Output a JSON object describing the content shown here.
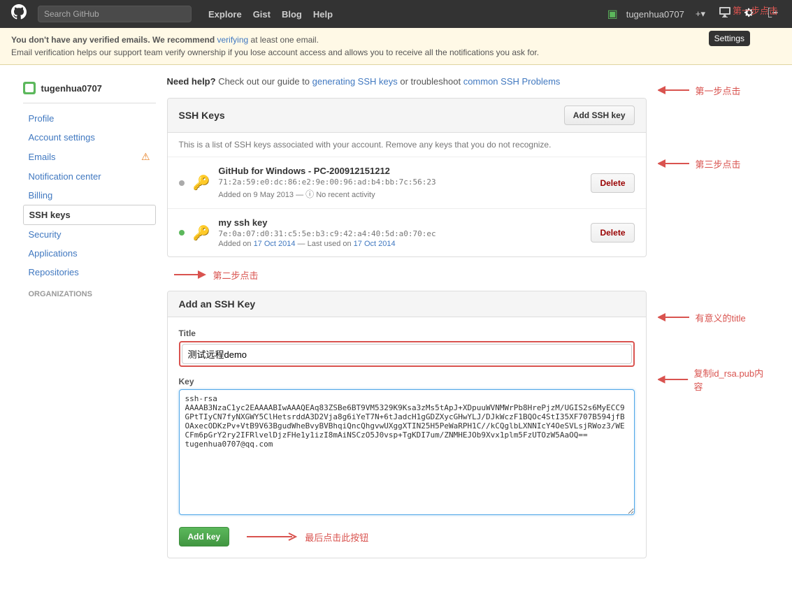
{
  "topNav": {
    "logo": "⬤",
    "searchPlaceholder": "Search GitHub",
    "links": [
      "Explore",
      "Gist",
      "Blog",
      "Help"
    ],
    "userName": "tugenhua0707",
    "plusLabel": "+▾",
    "settingsTooltip": "Settings"
  },
  "notificationBanner": {
    "text1": "You don't have any verified emails. We recommend ",
    "verifyLink": "verifying",
    "text2": " at least one email.",
    "text3": "Email verification helps our support team verify ownership if you lose account access and allows you to receive all the notifications you ask for."
  },
  "sidebar": {
    "userName": "tugenhua0707",
    "navItems": [
      {
        "label": "Profile",
        "id": "profile",
        "active": false
      },
      {
        "label": "Account settings",
        "id": "account-settings",
        "active": false
      },
      {
        "label": "Emails",
        "id": "emails",
        "active": false,
        "warning": true
      },
      {
        "label": "Notification center",
        "id": "notification-center",
        "active": false
      },
      {
        "label": "Billing",
        "id": "billing",
        "active": false
      },
      {
        "label": "SSH keys",
        "id": "ssh-keys",
        "active": true
      },
      {
        "label": "Security",
        "id": "security",
        "active": false
      },
      {
        "label": "Applications",
        "id": "applications",
        "active": false
      },
      {
        "label": "Repositories",
        "id": "repositories",
        "active": false
      }
    ],
    "orgsSectionLabel": "Organizations",
    "orgItems": []
  },
  "helpText": {
    "prefix": "Need help?",
    "text": " Check out our guide to ",
    "link1Text": "generating SSH keys",
    "link1Href": "#",
    "text2": " or troubleshoot ",
    "link2Text": "common SSH Problems",
    "link2Href": "#"
  },
  "sshKeys": {
    "sectionTitle": "SSH Keys",
    "addKeyButton": "Add SSH key",
    "infoText": "This is a list of SSH keys associated with your account. Remove any keys that you do not recognize.",
    "keys": [
      {
        "name": "GitHub for Windows - PC-200912151212",
        "fingerprint": "71:2a:59:e0:dc:86:e2:9e:00:96:ad:b4:bb:7c:56:23",
        "meta": "Added on 9 May 2013 — ⓘ No recent activity",
        "active": false
      },
      {
        "name": "my ssh key",
        "fingerprint": "7e:0a:07:d0:31:c5:5e:b3:c9:42:a4:40:5d:a0:70:ec",
        "meta": "Added on 17 Oct 2014 — Last used on 17 Oct 2014",
        "metaLink1": "17 Oct 2014",
        "metaLink2": "17 Oct 2014",
        "active": true
      }
    ],
    "deleteLabel": "Delete"
  },
  "addSSHKey": {
    "sectionTitle": "Add an SSH Key",
    "titleLabel": "Title",
    "titleValue": "测试远程demo",
    "keyLabel": "Key",
    "keyValue": "ssh-rsa\nAAAAB3NzaC1yc2EAAAABIwAAAQEAq83ZSBe6BT9VM5329K9Ksa3zMs5tApJ+XDpuuWVNMWrPb8HrePjzM/UGIS2s6MyECC9GPtTIyCN7fyNXGWY5ClHetsrddA3D2Vja8g6iYeT7N+6tJadcH1gGDZXycGHwYLJ/DJkWczF1BQOc4StI35XF707B594jfBOAxecODKzPv+VtB9V63BgudWheBvyBVBhqiQncQhgvwUXggXTIN25H5PeWaRPH1C//kCQglbLXNNIcY4OeSVLsjRWoz3/WECFm6pGrY2ry2IFRlvelDjzFHe1y1izI8mAiNSCzO5J0vsp+TgKDI7um/ZNMHEJOb9Xvx1plm5FzUTOzW5AaOQ== tugenhua0707@qq.com",
    "addKeyButton": "Add key"
  },
  "annotations": {
    "step1": "第一步点击",
    "step2": "第二步点击",
    "step3": "第三步点击",
    "titleNote": "有意义的title",
    "keyNote": "复制id_rsa.pub内容",
    "lastStep": "最后点击此按钮"
  }
}
